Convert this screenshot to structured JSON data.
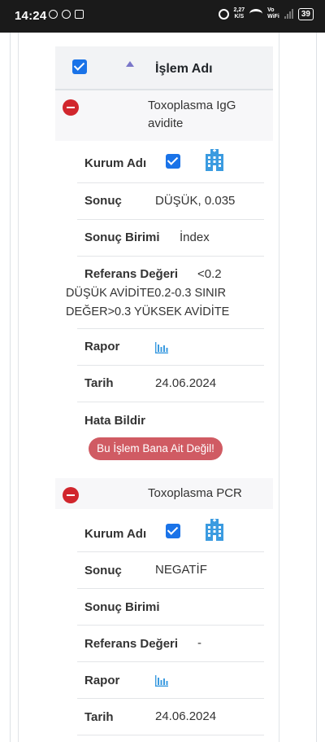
{
  "status_bar": {
    "time": "14:24",
    "net_speed_value": "2,27",
    "net_speed_unit": "K/S",
    "vo": "Vo",
    "wifi_label": "WiFi",
    "battery": "39"
  },
  "table_header": {
    "column_title": "İşlem Adı"
  },
  "records": [
    {
      "name_line1": "Toxoplasma IgG",
      "name_line2": "avidite",
      "kurum_label": "Kurum Adı",
      "sonuc_label": "Sonuç",
      "sonuc_value": "DÜŞÜK, 0.035",
      "birim_label": "Sonuç Birimi",
      "birim_value": "İndex",
      "referans_label": "Referans Değeri",
      "referans_value_line1": "<0.2",
      "referans_value_line2": "DÜŞÜK AVİDİTE0.2-0.3 SINIR",
      "referans_value_line3": "DEĞER>0.3 YÜKSEK AVİDİTE",
      "rapor_label": "Rapor",
      "tarih_label": "Tarih",
      "tarih_value": "24.06.2024",
      "hata_label": "Hata Bildir",
      "hata_button": "Bu İşlem Bana Ait Değil!"
    },
    {
      "name_line1": "Toxoplasma PCR",
      "kurum_label": "Kurum Adı",
      "sonuc_label": "Sonuç",
      "sonuc_value": "NEGATİF",
      "birim_label": "Sonuç Birimi",
      "referans_label": "Referans Değeri",
      "referans_value": "-",
      "rapor_label": "Rapor",
      "tarih_label": "Tarih",
      "tarih_value": "24.06.2024"
    }
  ],
  "colors": {
    "checkbox": "#1a73e8",
    "toggle_minus": "#d1262d",
    "error_button": "#d05b63",
    "icon_blue": "#3b9be0"
  },
  "icons": [
    "whatsapp-icon",
    "alarm-icon",
    "wifi-icon",
    "signal-icon",
    "battery-icon",
    "building-icon",
    "bar-chart-icon",
    "minus-circle-icon",
    "sort-up-icon",
    "checkbox-icon"
  ]
}
